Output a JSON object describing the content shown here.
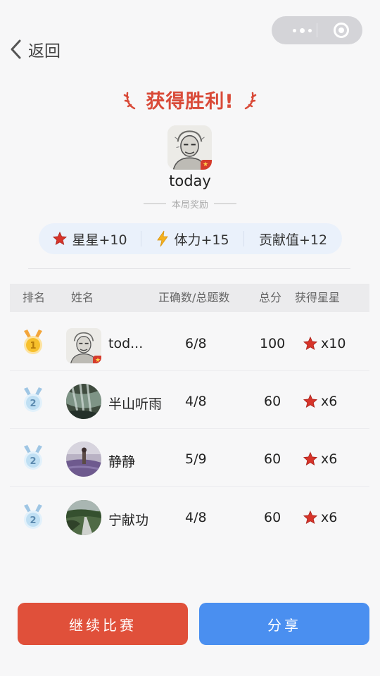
{
  "nav": {
    "back_label": "返回"
  },
  "header": {
    "title": "获得胜利!"
  },
  "player": {
    "name": "today"
  },
  "rewards": {
    "section_title": "本局奖励",
    "items": [
      {
        "icon": "star-icon",
        "label": "星星+10"
      },
      {
        "icon": "lightning-icon",
        "label": "体力+15"
      },
      {
        "icon": null,
        "label": "贡献值+12"
      }
    ]
  },
  "table": {
    "headers": [
      "排名",
      "姓名",
      "正确数/总题数",
      "总分",
      "获得星星"
    ],
    "rows": [
      {
        "rank": "1",
        "medal": "gold",
        "name": "tod...",
        "correct": "6/8",
        "score": "100",
        "stars": "x10",
        "avatar": "sketch-portrait"
      },
      {
        "rank": "2",
        "medal": "silver",
        "name": "半山听雨",
        "correct": "4/8",
        "score": "60",
        "stars": "x6",
        "avatar": "waterfall-photo"
      },
      {
        "rank": "2",
        "medal": "silver",
        "name": "静静",
        "correct": "5/9",
        "score": "60",
        "stars": "x6",
        "avatar": "lavender-photo"
      },
      {
        "rank": "2",
        "medal": "silver",
        "name": "宁献功",
        "correct": "4/8",
        "score": "60",
        "stars": "x6",
        "avatar": "road-photo"
      }
    ]
  },
  "buttons": {
    "continue": "继续比赛",
    "share": "分享"
  },
  "colors": {
    "win_red": "#d94a38",
    "primary_red": "#e0503a",
    "primary_blue": "#4a8ff0",
    "star_red": "#d7342a"
  }
}
